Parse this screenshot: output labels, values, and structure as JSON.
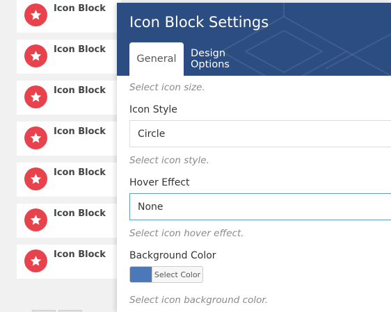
{
  "element_list": {
    "items": [
      {
        "label": "Icon Block",
        "icon": "star-icon"
      },
      {
        "label": "Icon Block",
        "icon": "star-icon"
      },
      {
        "label": "Icon Block",
        "icon": "star-icon"
      },
      {
        "label": "Icon Block",
        "icon": "star-icon"
      },
      {
        "label": "Icon Block",
        "icon": "star-icon"
      },
      {
        "label": "Icon Block",
        "icon": "star-icon"
      },
      {
        "label": "Icon Block",
        "icon": "star-icon"
      }
    ],
    "icon_color": "#e8424d"
  },
  "modal": {
    "title": "Icon Block Settings",
    "header_color": "#2c4d82",
    "tabs": [
      {
        "label": "General",
        "active": true
      },
      {
        "label": "Design Options",
        "active": false
      }
    ],
    "fields": {
      "icon_size_help": "Select icon size.",
      "icon_style": {
        "label": "Icon Style",
        "value": "Circle",
        "help": "Select icon style."
      },
      "hover_effect": {
        "label": "Hover Effect",
        "value": "None",
        "help": "Select icon hover effect."
      },
      "background_color": {
        "label": "Background Color",
        "button_label": "Select Color",
        "swatch": "#4a78b8",
        "help": "Select icon background color."
      }
    }
  }
}
